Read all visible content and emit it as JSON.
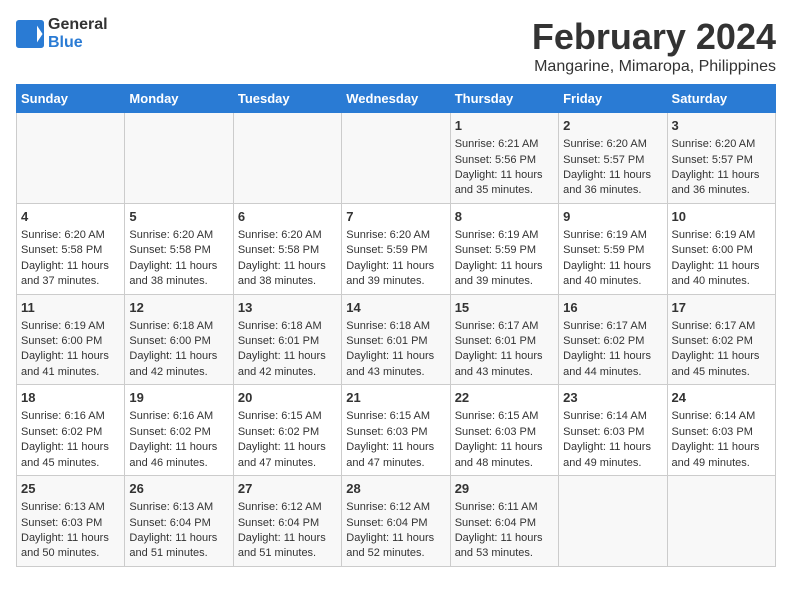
{
  "logo": {
    "line1": "General",
    "line2": "Blue"
  },
  "title": "February 2024",
  "location": "Mangarine, Mimaropa, Philippines",
  "days_of_week": [
    "Sunday",
    "Monday",
    "Tuesday",
    "Wednesday",
    "Thursday",
    "Friday",
    "Saturday"
  ],
  "weeks": [
    [
      {
        "day": "",
        "content": ""
      },
      {
        "day": "",
        "content": ""
      },
      {
        "day": "",
        "content": ""
      },
      {
        "day": "",
        "content": ""
      },
      {
        "day": "1",
        "content": "Sunrise: 6:21 AM\nSunset: 5:56 PM\nDaylight: 11 hours\nand 35 minutes."
      },
      {
        "day": "2",
        "content": "Sunrise: 6:20 AM\nSunset: 5:57 PM\nDaylight: 11 hours\nand 36 minutes."
      },
      {
        "day": "3",
        "content": "Sunrise: 6:20 AM\nSunset: 5:57 PM\nDaylight: 11 hours\nand 36 minutes."
      }
    ],
    [
      {
        "day": "4",
        "content": "Sunrise: 6:20 AM\nSunset: 5:58 PM\nDaylight: 11 hours\nand 37 minutes."
      },
      {
        "day": "5",
        "content": "Sunrise: 6:20 AM\nSunset: 5:58 PM\nDaylight: 11 hours\nand 38 minutes."
      },
      {
        "day": "6",
        "content": "Sunrise: 6:20 AM\nSunset: 5:58 PM\nDaylight: 11 hours\nand 38 minutes."
      },
      {
        "day": "7",
        "content": "Sunrise: 6:20 AM\nSunset: 5:59 PM\nDaylight: 11 hours\nand 39 minutes."
      },
      {
        "day": "8",
        "content": "Sunrise: 6:19 AM\nSunset: 5:59 PM\nDaylight: 11 hours\nand 39 minutes."
      },
      {
        "day": "9",
        "content": "Sunrise: 6:19 AM\nSunset: 5:59 PM\nDaylight: 11 hours\nand 40 minutes."
      },
      {
        "day": "10",
        "content": "Sunrise: 6:19 AM\nSunset: 6:00 PM\nDaylight: 11 hours\nand 40 minutes."
      }
    ],
    [
      {
        "day": "11",
        "content": "Sunrise: 6:19 AM\nSunset: 6:00 PM\nDaylight: 11 hours\nand 41 minutes."
      },
      {
        "day": "12",
        "content": "Sunrise: 6:18 AM\nSunset: 6:00 PM\nDaylight: 11 hours\nand 42 minutes."
      },
      {
        "day": "13",
        "content": "Sunrise: 6:18 AM\nSunset: 6:01 PM\nDaylight: 11 hours\nand 42 minutes."
      },
      {
        "day": "14",
        "content": "Sunrise: 6:18 AM\nSunset: 6:01 PM\nDaylight: 11 hours\nand 43 minutes."
      },
      {
        "day": "15",
        "content": "Sunrise: 6:17 AM\nSunset: 6:01 PM\nDaylight: 11 hours\nand 43 minutes."
      },
      {
        "day": "16",
        "content": "Sunrise: 6:17 AM\nSunset: 6:02 PM\nDaylight: 11 hours\nand 44 minutes."
      },
      {
        "day": "17",
        "content": "Sunrise: 6:17 AM\nSunset: 6:02 PM\nDaylight: 11 hours\nand 45 minutes."
      }
    ],
    [
      {
        "day": "18",
        "content": "Sunrise: 6:16 AM\nSunset: 6:02 PM\nDaylight: 11 hours\nand 45 minutes."
      },
      {
        "day": "19",
        "content": "Sunrise: 6:16 AM\nSunset: 6:02 PM\nDaylight: 11 hours\nand 46 minutes."
      },
      {
        "day": "20",
        "content": "Sunrise: 6:15 AM\nSunset: 6:02 PM\nDaylight: 11 hours\nand 47 minutes."
      },
      {
        "day": "21",
        "content": "Sunrise: 6:15 AM\nSunset: 6:03 PM\nDaylight: 11 hours\nand 47 minutes."
      },
      {
        "day": "22",
        "content": "Sunrise: 6:15 AM\nSunset: 6:03 PM\nDaylight: 11 hours\nand 48 minutes."
      },
      {
        "day": "23",
        "content": "Sunrise: 6:14 AM\nSunset: 6:03 PM\nDaylight: 11 hours\nand 49 minutes."
      },
      {
        "day": "24",
        "content": "Sunrise: 6:14 AM\nSunset: 6:03 PM\nDaylight: 11 hours\nand 49 minutes."
      }
    ],
    [
      {
        "day": "25",
        "content": "Sunrise: 6:13 AM\nSunset: 6:03 PM\nDaylight: 11 hours\nand 50 minutes."
      },
      {
        "day": "26",
        "content": "Sunrise: 6:13 AM\nSunset: 6:04 PM\nDaylight: 11 hours\nand 51 minutes."
      },
      {
        "day": "27",
        "content": "Sunrise: 6:12 AM\nSunset: 6:04 PM\nDaylight: 11 hours\nand 51 minutes."
      },
      {
        "day": "28",
        "content": "Sunrise: 6:12 AM\nSunset: 6:04 PM\nDaylight: 11 hours\nand 52 minutes."
      },
      {
        "day": "29",
        "content": "Sunrise: 6:11 AM\nSunset: 6:04 PM\nDaylight: 11 hours\nand 53 minutes."
      },
      {
        "day": "",
        "content": ""
      },
      {
        "day": "",
        "content": ""
      }
    ]
  ]
}
